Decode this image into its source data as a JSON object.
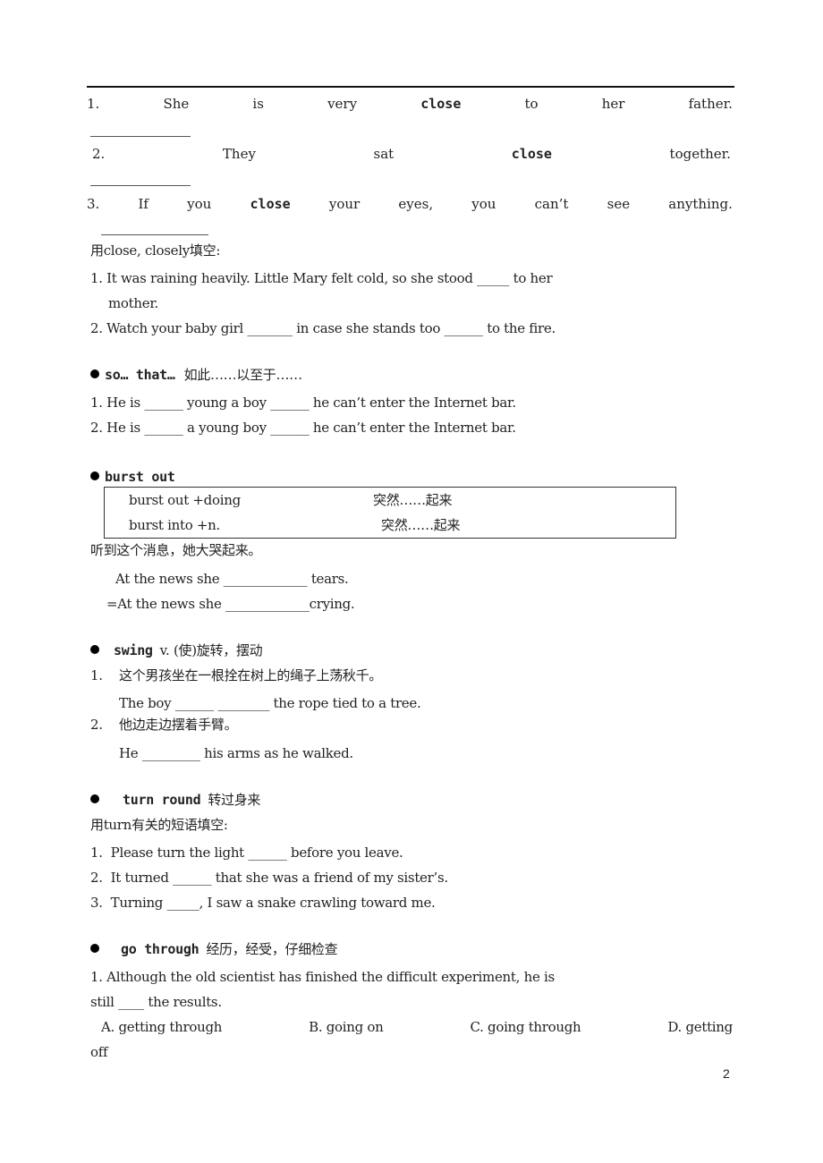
{
  "section_close": {
    "examples": [
      {
        "words": [
          "1.",
          "She",
          "is",
          "very",
          "close",
          "to",
          "her",
          "father."
        ],
        "bold_index": 4
      },
      {
        "words": [
          "2.",
          "They",
          "sat",
          "close",
          "together."
        ],
        "bold_index": 3
      },
      {
        "words": [
          "3.",
          "If",
          "you",
          "close",
          "your",
          "eyes,",
          "you",
          "can’t",
          "see",
          "anything."
        ],
        "bold_index": 3
      }
    ],
    "instruction": "用close, closely填空:",
    "exercises": [
      {
        "line1": "1. It was raining heavily. Little Mary felt cold, so she stood _____ to her",
        "line2": "mother."
      },
      {
        "line1": "2. Watch your baby girl _______ in case she stands too ______ to the fire."
      }
    ]
  },
  "section_so_that": {
    "heading_en": "so… that…",
    "heading_cn": "如此……以至于……",
    "items": [
      "1. He is ______ young a boy ______ he can’t enter the Internet bar.",
      "2. He is ______ a young boy ______ he can’t enter the Internet bar."
    ]
  },
  "section_burst_out": {
    "heading_en": "burst out",
    "table": [
      {
        "phrase": "burst out +doing",
        "meaning": "突然……起来"
      },
      {
        "phrase": "burst into +n.",
        "meaning": "突然……起来"
      }
    ],
    "prompt_cn": "听到这个消息，她大哭起来。",
    "answers": [
      "At the news she _____________ tears.",
      "=At the news she _____________crying."
    ]
  },
  "section_swing": {
    "heading_en": "swing",
    "heading_rest": "v. (使)旋转，摆动",
    "items": [
      {
        "num": "1.",
        "cn": "这个男孩坐在一根拴在树上的绳子上荡秋千。",
        "en": "The boy ______ ________ the rope tied to a tree."
      },
      {
        "num": "2.",
        "cn": "他边走边摆着手臂。",
        "en": "He _________ his arms as he walked."
      }
    ]
  },
  "section_turn_round": {
    "heading_en": "turn round",
    "heading_cn": "转过身来",
    "instruction": "用turn有关的短语填空:",
    "items": [
      "1.  Please turn the light ______ before you leave.",
      "2.  It turned ______ that she was a friend of my sister’s.",
      "3.  Turning _____, I saw a snake crawling toward me."
    ]
  },
  "section_go_through": {
    "heading_en": "go through",
    "heading_cn": "经历，经受，仔细检查",
    "question_line1": "1. Although the old scientist has finished the difficult experiment, he is",
    "question_line2": "still ____ the results.",
    "options": [
      "A. getting through",
      "B. going on",
      "C. going through",
      "D. getting"
    ],
    "options_wrap": "off"
  },
  "page_number": "2"
}
